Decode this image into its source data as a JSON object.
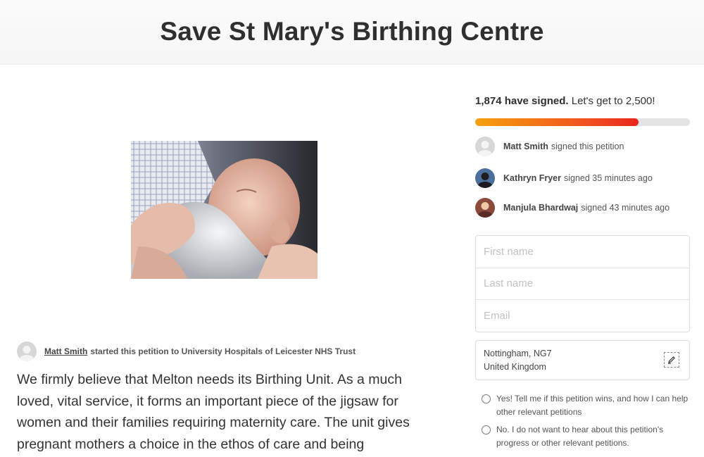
{
  "page": {
    "title": "Save St Mary's Birthing Centre"
  },
  "petition": {
    "starter_name": "Matt Smith",
    "starter_text": "started this petition to University Hospitals of Leicester NHS Trust",
    "description": "We firmly believe that Melton needs its Birthing Unit.  As a much loved, vital service, it forms an important piece of the jigsaw for women and their families requiring maternity care.  The unit gives pregnant mothers a choice in the ethos of care and being"
  },
  "progress": {
    "signed_count": "1,874 have signed.",
    "goal_text": "Let's get to 2,500!",
    "fraction": 0.76
  },
  "signers": [
    {
      "name": "Matt Smith",
      "action": "signed this petition"
    },
    {
      "name": "Kathryn Fryer",
      "action": "signed 35 minutes ago"
    },
    {
      "name": "Manjula Bhardwaj",
      "action": "signed 43 minutes ago"
    }
  ],
  "form": {
    "first_name_placeholder": "First name",
    "last_name_placeholder": "Last name",
    "email_placeholder": "Email",
    "location_line1": "Nottingham, NG7",
    "location_line2": "United Kingdom"
  },
  "options": [
    {
      "label": "Yes! Tell me if this petition wins, and how I can help other relevant petitions"
    },
    {
      "label": "No. I do not want to hear about this petition's progress or other relevant petitions."
    }
  ],
  "colors": {
    "progress_start": "#f5a10f",
    "progress_end": "#e8261a"
  }
}
